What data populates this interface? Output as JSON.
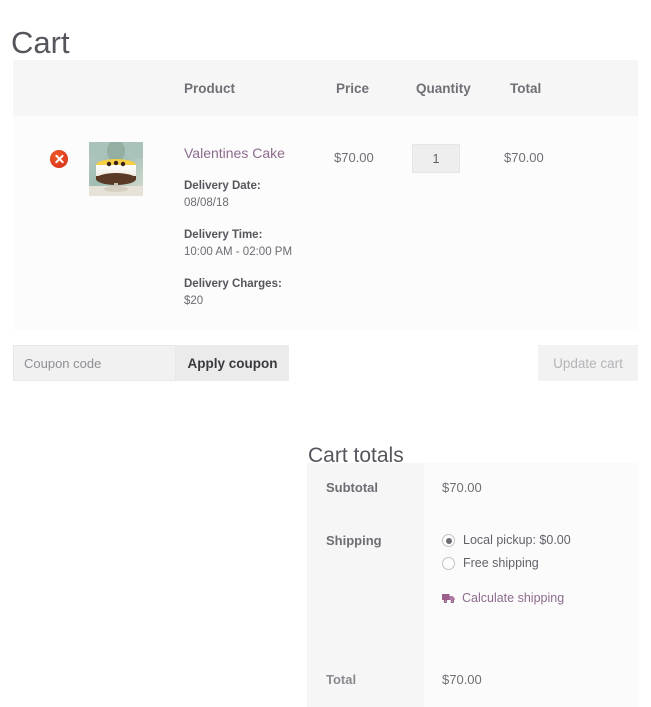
{
  "page": {
    "title": "Cart"
  },
  "cart_table": {
    "headers": {
      "product": "Product",
      "price": "Price",
      "quantity": "Quantity",
      "total": "Total"
    },
    "items": [
      {
        "remove_icon": "remove-circle-icon",
        "thumbnail_icon": "product-thumbnail-cake",
        "name": "Valentines Cake",
        "price": "$70.00",
        "quantity": "1",
        "total": "$70.00",
        "meta": [
          {
            "label": "Delivery Date:",
            "value": "08/08/18"
          },
          {
            "label": "Delivery Time:",
            "value": "10:00 AM - 02:00 PM"
          },
          {
            "label": "Delivery Charges:",
            "value": "$20"
          }
        ]
      }
    ]
  },
  "coupon": {
    "placeholder": "Coupon code",
    "value": "",
    "apply_label": "Apply coupon",
    "update_label": "Update cart"
  },
  "totals": {
    "title": "Cart totals",
    "subtotal_label": "Subtotal",
    "subtotal_value": "$70.00",
    "shipping_label": "Shipping",
    "shipping_options": [
      {
        "label": "Local pickup: $0.00",
        "selected": true
      },
      {
        "label": "Free shipping",
        "selected": false
      }
    ],
    "calculate_shipping_label": "Calculate shipping",
    "calculate_shipping_icon": "truck-icon",
    "total_label": "Total",
    "total_value": "$70.00"
  },
  "colors": {
    "link": "#8d6b8d",
    "remove": "#e0401f",
    "header_bg": "#f6f6f6",
    "row_bg": "#fcfcfc",
    "button_bg": "#ebebeb",
    "disabled_text": "#b4b4b8"
  }
}
